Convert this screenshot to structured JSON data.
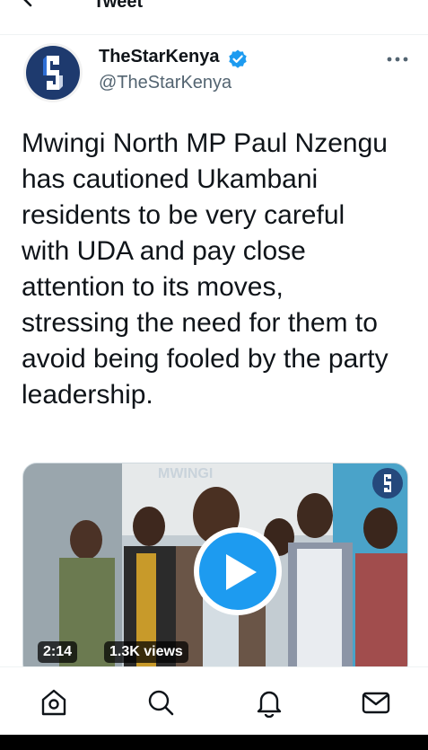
{
  "header": {
    "title": "Tweet"
  },
  "tweet": {
    "author_name": "TheStarKenya",
    "handle": "@TheStarKenya",
    "text": "Mwingi North MP Paul Nzengu has cautioned Ukambani residents to be very careful with UDA and pay close attention to its moves, stressing the need for them to avoid being fooled by the party leadership."
  },
  "media": {
    "duration": "2:14",
    "views": "1.3K views",
    "wall_sign": "MWINGI"
  },
  "colors": {
    "accent": "#1d9bf0",
    "brand_navy": "#1e3a6e",
    "text": "#0f1419",
    "secondary": "#536471"
  }
}
